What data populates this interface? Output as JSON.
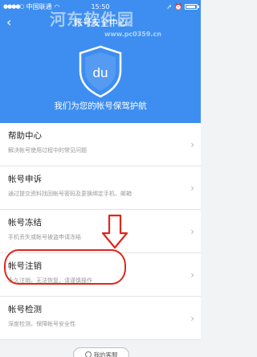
{
  "status_bar": {
    "signal": "●●●●○",
    "carrier": "中国联通",
    "wifi": "◠",
    "time": "15:50",
    "location_icon": "➚",
    "alarm_icon": "⏰"
  },
  "nav": {
    "back_icon": "‹",
    "title": "帐号安全中心"
  },
  "watermark": {
    "text": "河东软件园",
    "url": "www.pc0359.cn"
  },
  "hero": {
    "shield_text": "du",
    "slogan": "我们为您的帐号保驾护航"
  },
  "menu": [
    {
      "label": "帮助中心",
      "desc": "解决帐号使用过程中的常见问题"
    },
    {
      "label": "帐号申诉",
      "desc": "通过提交资料找回帐号密码及更换绑定手机、邮箱"
    },
    {
      "label": "帐号冻结",
      "desc": "手机丢失或帐号被盗申请冻结"
    },
    {
      "label": "帐号注销",
      "desc": "永久注销，无法恢复，请谨慎操作"
    },
    {
      "label": "帐号检测",
      "desc": "深度检测，保障帐号安全性"
    }
  ],
  "chevron": "›",
  "footer": {
    "label": "我的客服"
  },
  "colors": {
    "primary": "#3d8ef0",
    "highlight": "#e0261c"
  }
}
